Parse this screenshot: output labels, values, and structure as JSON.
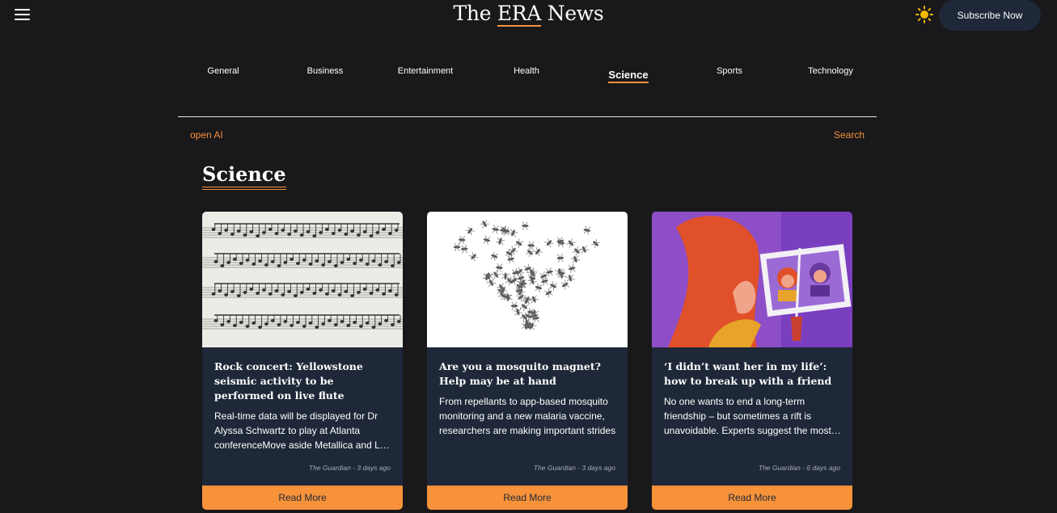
{
  "header": {
    "title_prefix": "The ",
    "title_accent": "ERA",
    "title_suffix": " News",
    "subscribe_label": "Subscribe Now",
    "theme_icon": "sun-icon",
    "menu_icon": "hamburger-menu-icon"
  },
  "nav": {
    "items": [
      {
        "label": "General"
      },
      {
        "label": "Business"
      },
      {
        "label": "Entertainment"
      },
      {
        "label": "Health"
      },
      {
        "label": "Science"
      },
      {
        "label": "Sports"
      },
      {
        "label": "Technology"
      }
    ],
    "active": "Science"
  },
  "subnav": {
    "left_link": "open AI",
    "right_link": "Search"
  },
  "section": {
    "title": "Science"
  },
  "cards": [
    {
      "image": "sheet-music-image",
      "title": "Rock concert: Yellowstone seismic activity to be performed on live flute",
      "description": "Real-time data will be displayed for Dr Alyssa Schwartz to play at Atlanta conferenceMove aside Metallica and Led Zeppelin",
      "meta": "The Guardian - 3 days ago",
      "button": "Read More"
    },
    {
      "image": "mosquito-swarm-image",
      "title": "Are you a mosquito magnet? Help may be at hand",
      "description": "From repellants to app-based mosquito monitoring and a new malaria vaccine, researchers are making important strides",
      "meta": "The Guardian - 3 days ago",
      "button": "Read More"
    },
    {
      "image": "friend-photo-illustration",
      "title": "‘I didn’t want her in my life’: how to break up with a friend",
      "description": "No one wants to end a long-term friendship – but sometimes a rift is unavoidable. Experts suggest the most compassionate way",
      "meta": "The Guardian - 6 days ago",
      "button": "Read More"
    }
  ],
  "colors": {
    "background": "#19181b",
    "card": "#1e2838",
    "accent": "#f7923a"
  }
}
